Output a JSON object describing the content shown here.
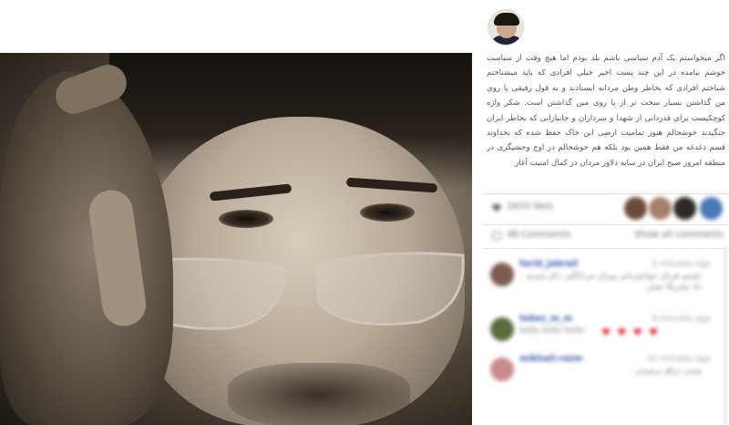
{
  "post": {
    "caption": "اگر میخواستم یک آدم سیاسی باشم بلد بودم اما هیچ وقت از سیاست خوشم نیامده در این چند پست اخیر خیلی افرادی که باید میشناختم شناختم افرادی که بخاطر وطن مردانه ایستادند و به قول رفیقی پا روی من گذاشتن بسیار سخت تر از پا روی مین گذاشتن است. شکر واژه کوچکیست برای قدردانی از شهدا و سرداران و جانبازانی که بخاطر ایران جنگیدند خوشحالم هنوز تمامیت ارضی این خاک حفظ شده که بخداوند قسم دغدغه من فقط همین بود بلکه هم خوشحالم در اوج وحشیگری در منطقه امروز صبح ایران در سایه دلاور مردان در کمال امنیت آغاز"
  },
  "likes": {
    "text": "1633 likes",
    "likers": [
      {
        "color": "#6b4a3a"
      },
      {
        "color": "#a58068"
      },
      {
        "color": "#2e2924"
      },
      {
        "color": "#4a79b8"
      }
    ]
  },
  "comments_meta": {
    "count_text": "48 Comments",
    "show_all": "Show all comments"
  },
  "comments": [
    {
      "username": "farid_jabrail",
      "time": "5 minutes ago",
      "text": "عسیم قربان جوانمردانی ویران مردانگیز، دکر منیدی داد تشریکا نشتر",
      "avatar_color": "#7d5c4f",
      "hearts": ""
    },
    {
      "username": "tekes_m_m",
      "time": "9 minutes ago",
      "text": "hello hello hello",
      "avatar_color": "#5a6b3e",
      "hearts": "♥ ♥ ♥ ♥"
    },
    {
      "username": "mikhail.razm",
      "time": "10 minutes ago",
      "text": "ضمی دراق ترسیدن",
      "avatar_color": "#c98b8b",
      "hearts": ""
    }
  ]
}
